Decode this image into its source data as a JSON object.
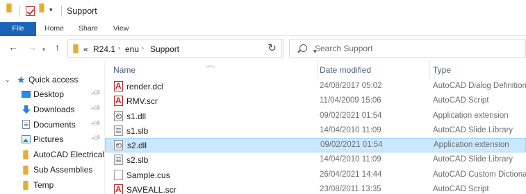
{
  "window": {
    "title": "Support"
  },
  "ribbon": {
    "tabs": [
      {
        "label": "File"
      },
      {
        "label": "Home"
      },
      {
        "label": "Share"
      },
      {
        "label": "View"
      }
    ]
  },
  "navigation": {
    "back_icon": "back-arrow-icon",
    "forward_icon": "forward-arrow-icon",
    "recent_icon": "chevron-down-icon",
    "up_icon": "up-arrow-icon",
    "address": {
      "prefix": "«",
      "segments": [
        "R24.1",
        "enu",
        "Support"
      ],
      "separator": "›"
    },
    "refresh_icon": "refresh-icon",
    "search": {
      "placeholder": "Search Support"
    }
  },
  "sidebar": {
    "quick_access_label": "Quick access",
    "items": [
      {
        "label": "Desktop",
        "icon": "desktop-icon",
        "pinned": true
      },
      {
        "label": "Downloads",
        "icon": "download-icon",
        "pinned": true
      },
      {
        "label": "Documents",
        "icon": "documents-icon",
        "pinned": true
      },
      {
        "label": "Pictures",
        "icon": "pictures-icon",
        "pinned": true
      },
      {
        "label": "AutoCAD Electrical",
        "icon": "folder-icon",
        "pinned": false
      },
      {
        "label": "Sub Assemblies",
        "icon": "folder-icon",
        "pinned": false
      },
      {
        "label": "Temp",
        "icon": "folder-icon",
        "pinned": false
      }
    ]
  },
  "filelist": {
    "columns": {
      "name": "Name",
      "date": "Date modified",
      "type": "Type"
    },
    "sort_column": "name",
    "files": [
      {
        "name": "render.dcl",
        "date": "24/08/2017 05:02",
        "type": "AutoCAD Dialog Definition",
        "icon": "autocad-file-icon"
      },
      {
        "name": "RMV.scr",
        "date": "11/04/2009 15:06",
        "type": "AutoCAD Script",
        "icon": "autocad-file-icon"
      },
      {
        "name": "s1.dll",
        "date": "09/02/2021 01:54",
        "type": "Application extension",
        "icon": "dll-file-icon"
      },
      {
        "name": "s1.slb",
        "date": "14/04/2010 11:09",
        "type": "AutoCAD Slide Library",
        "icon": "slide-library-icon"
      },
      {
        "name": "s2.dll",
        "date": "09/02/2021 01:54",
        "type": "Application extension",
        "icon": "dll-file-icon",
        "selected": true
      },
      {
        "name": "s2.slb",
        "date": "14/04/2010 11:09",
        "type": "AutoCAD Slide Library",
        "icon": "slide-library-icon"
      },
      {
        "name": "Sample.cus",
        "date": "26/04/2021 14:44",
        "type": "AutoCAD Custom Dictionary",
        "icon": "generic-file-icon"
      },
      {
        "name": "SAVEALL.scr",
        "date": "23/08/2011 13:35",
        "type": "AutoCAD Script",
        "icon": "autocad-file-icon"
      }
    ]
  },
  "colors": {
    "file_tab_bg": "#1a63b8",
    "selection_bg": "#cce8ff",
    "selection_border": "#99d1ff",
    "folder_yellow": "#f2c55c",
    "autocad_red": "#c62828"
  }
}
